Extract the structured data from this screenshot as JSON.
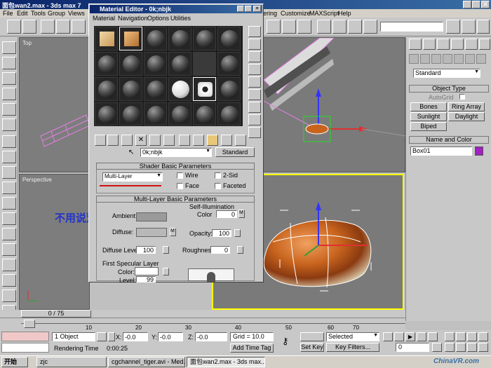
{
  "titlebar": {
    "title": "面包wan2.max - 3ds max 7"
  },
  "menubar": {
    "items": [
      "File",
      "Edit",
      "Tools",
      "Group",
      "Views"
    ],
    "right_items": [
      "ering",
      "Customize",
      "MAXScript",
      "Help"
    ]
  },
  "viewports": {
    "top": "Top",
    "perspective": "Perspective"
  },
  "material_editor": {
    "title": "Material Editor - 0k;nbjk",
    "menu": [
      "Material",
      "Navigation",
      "Options",
      "Utilities"
    ],
    "material_name": "0k;nbjk",
    "type_button": "Standard",
    "shader_rollout": "Shader Basic Parameters",
    "shader_value": "Multi-Layer",
    "wire": "Wire",
    "two_sided": "2-Sid",
    "face": "Face",
    "faceted": "Faceted",
    "multilayer_rollout": "Multi-Layer Basic Parameters",
    "self_illum": "Self-Illumination",
    "color_label": "Color",
    "color_value": "0",
    "ambient": "Ambient:",
    "diffuse": "Diffuse:",
    "opacity_label": "Opacity:",
    "opacity_value": "100",
    "diffuse_level_label": "Diffuse Level:",
    "diffuse_level_value": "100",
    "roughness_label": "Roughness:",
    "roughness_value": "0",
    "first_specular": "First Specular Layer",
    "spec_color": "Color:",
    "spec_level": "Level:",
    "spec_level_value": "99"
  },
  "annotation": {
    "text": "不用说双层高光为了产生油感",
    "color": "#2233cc"
  },
  "command_panel": {
    "dropdown": "Standard",
    "object_type_header": "Object Type",
    "autogrid": "AutoGrid",
    "buttons": [
      "Bones",
      "Ring Array",
      "Sunlight",
      "Daylight",
      "Biped"
    ],
    "name_color_header": "Name and Color",
    "object_name": "Box01",
    "object_color": "#a020c0"
  },
  "timeline": {
    "frame_display": "0 / 75",
    "ticks": [
      "0",
      "10",
      "20",
      "30",
      "40",
      "50",
      "60",
      "70"
    ]
  },
  "status": {
    "selection": "1 Object",
    "x_label": "X:",
    "x_value": "-0.0",
    "y_label": "Y:",
    "y_value": "-0.0",
    "z_label": "Z:",
    "z_value": "-0.0",
    "grid": "Grid = 10.0",
    "rendering_time_label": "Rendering Time",
    "rendering_time": "0:00:25",
    "add_time_tag": "Add Time Tag",
    "auto_key_state": "Selected",
    "set_key": "Set Key",
    "key_filters": "Key Filters...",
    "frame_value": "0"
  },
  "taskbar": {
    "start": "开始",
    "tasks": [
      "zjc",
      "cgchannel_tiger.avi - Med...",
      "面包wan2.max - 3ds max..."
    ],
    "watermark": "ChinaVR.com"
  },
  "colors": {
    "title_blue": "#0a246a",
    "bread_orange": "#c8641e",
    "viewport_border": "#ffff00"
  }
}
